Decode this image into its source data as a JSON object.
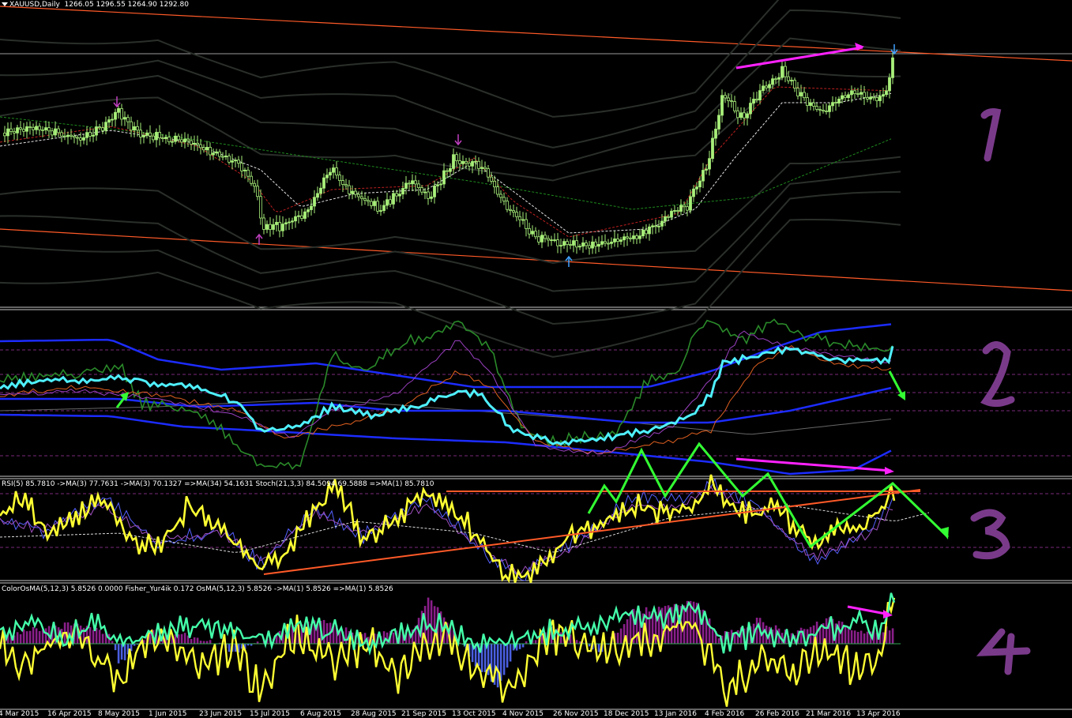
{
  "header": {
    "symbol": "XAUUSD,Daily",
    "ohlc": "1266.05 1296.55 1264.90 1292.80"
  },
  "panes": {
    "rsi_header": "RSI(5) 85.7810  ->MA(3) 77.7631  ->MA(3) 70.1327  =>MA(34) 54.1631  Stoch(21,3,3) 84.5094 69.5888  =>MA(1) 85.7810",
    "osma_header": "ColorOsMA(5,12,3) 5.8526 0.0000  Fisher_Yur4ik 0.172  OsMA(5,12,3) 5.8526  ->MA(1) 5.8526  =>MA(1) 5.8526"
  },
  "annotations": [
    "1",
    "2",
    "3",
    "4"
  ],
  "x_axis": {
    "ticks": [
      "4 Mar 2015",
      "16 Apr 2015",
      "8 May 2015",
      "1 Jun 2015",
      "23 Jun 2015",
      "15 Jul 2015",
      "6 Aug 2015",
      "28 Aug 2015",
      "21 Sep 2015",
      "13 Oct 2015",
      "4 Nov 2015",
      "26 Nov 2015",
      "18 Dec 2015",
      "13 Jan 2016",
      "4 Feb 2016",
      "26 Feb 2016",
      "21 Mar 2016",
      "13 Apr 2016"
    ]
  },
  "colors": {
    "background": "#000000",
    "candles": "#a8f07a",
    "channel": "#ff5a28",
    "envelope": "#2a2f2a",
    "rsi": "#ffff33",
    "fast_line": "#44ffaa",
    "cyan_line": "#4ff0ff",
    "bands": "#1c2cff",
    "green_osc": "#2a8a2a",
    "magenta": "#ff22ff",
    "green_arrow": "#33ff33",
    "hist_pos": "#8a1f8a",
    "hist_neg": "#4a5fe0",
    "annotation": "#7a3a8a"
  },
  "chart_data": {
    "type": "candlestick",
    "symbol": "XAUUSD",
    "timeframe": "Daily",
    "last_bar": {
      "open": 1266.05,
      "high": 1296.55,
      "low": 1264.9,
      "close": 1292.8
    },
    "indicators": {
      "RSI(5)": 85.781,
      "RSI MA(3)": 77.7631,
      "RSI MA(3) #2": 70.1327,
      "RSI MA(34)": 54.1631,
      "Stoch(21,3,3)": [
        84.5094,
        69.5888
      ],
      "Stoch MA(1)": 85.781,
      "ColorOsMA(5,12,3)": [
        5.8526,
        0.0
      ],
      "Fisher_Yur4ik": 0.172,
      "OsMA(5,12,3)": 5.8526,
      "OsMA MA(1)": 5.8526,
      "OsMA MA(1) #2": 5.8526
    },
    "x_ticks": [
      "4 Mar 2015",
      "16 Apr 2015",
      "8 May 2015",
      "1 Jun 2015",
      "23 Jun 2015",
      "15 Jul 2015",
      "6 Aug 2015",
      "28 Aug 2015",
      "21 Sep 2015",
      "13 Oct 2015",
      "4 Nov 2015",
      "26 Nov 2015",
      "18 Dec 2015",
      "13 Jan 2016",
      "4 Feb 2016",
      "26 Feb 2016",
      "21 Mar 2016",
      "13 Apr 2016"
    ]
  }
}
